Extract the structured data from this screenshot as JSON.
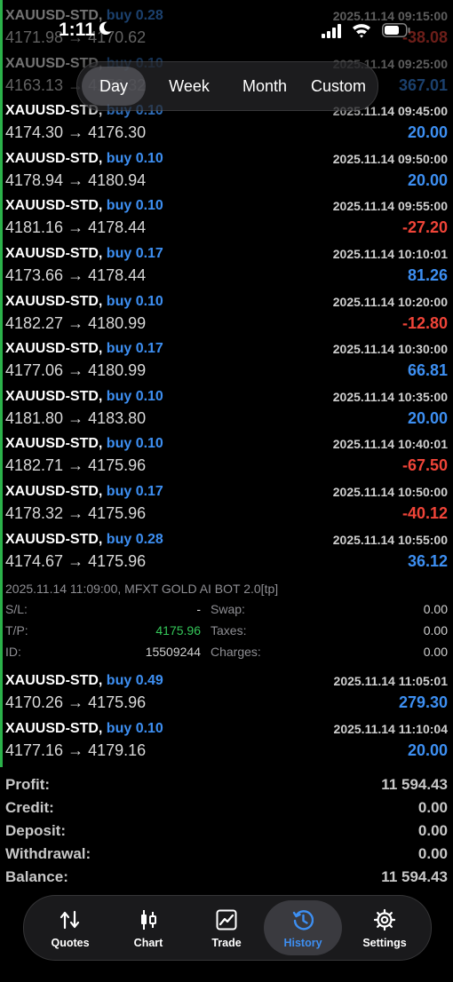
{
  "status_bar": {
    "time": "1:11"
  },
  "period_tabs": [
    "Day",
    "Week",
    "Month",
    "Custom"
  ],
  "deals": [
    {
      "symbol": "XAUUSD-STD,",
      "side": "buy 0.28",
      "datetime": "2025.11.14 09:15:00",
      "prices": "4171.98 → 4170.62",
      "profit": "-38.08",
      "dim": true
    },
    {
      "symbol": "XAUUSD-STD,",
      "side": "buy 0.10",
      "datetime": "2025.11.14 09:25:00",
      "prices": "4163.13 → 4176.32",
      "profit": "367.01",
      "dim": true
    },
    {
      "symbol": "XAUUSD-STD,",
      "side": "buy 0.10",
      "datetime": "2025.11.14 09:45:00",
      "prices": "4174.30 → 4176.30",
      "profit": "20.00"
    },
    {
      "symbol": "XAUUSD-STD,",
      "side": "buy 0.10",
      "datetime": "2025.11.14 09:50:00",
      "prices": "4178.94 → 4180.94",
      "profit": "20.00"
    },
    {
      "symbol": "XAUUSD-STD,",
      "side": "buy 0.10",
      "datetime": "2025.11.14 09:55:00",
      "prices": "4181.16 → 4178.44",
      "profit": "-27.20"
    },
    {
      "symbol": "XAUUSD-STD,",
      "side": "buy 0.17",
      "datetime": "2025.11.14 10:10:01",
      "prices": "4173.66 → 4178.44",
      "profit": "81.26"
    },
    {
      "symbol": "XAUUSD-STD,",
      "side": "buy 0.10",
      "datetime": "2025.11.14 10:20:00",
      "prices": "4182.27 → 4180.99",
      "profit": "-12.80"
    },
    {
      "symbol": "XAUUSD-STD,",
      "side": "buy 0.17",
      "datetime": "2025.11.14 10:30:00",
      "prices": "4177.06 → 4180.99",
      "profit": "66.81"
    },
    {
      "symbol": "XAUUSD-STD,",
      "side": "buy 0.10",
      "datetime": "2025.11.14 10:35:00",
      "prices": "4181.80 → 4183.80",
      "profit": "20.00"
    },
    {
      "symbol": "XAUUSD-STD,",
      "side": "buy 0.10",
      "datetime": "2025.11.14 10:40:01",
      "prices": "4182.71 → 4175.96",
      "profit": "-67.50"
    },
    {
      "symbol": "XAUUSD-STD,",
      "side": "buy 0.17",
      "datetime": "2025.11.14 10:50:00",
      "prices": "4178.32 → 4175.96",
      "profit": "-40.12"
    },
    {
      "symbol": "XAUUSD-STD,",
      "side": "buy 0.28",
      "datetime": "2025.11.14 10:55:00",
      "prices": "4174.67 → 4175.96",
      "profit": "36.12"
    }
  ],
  "details": {
    "header": "2025.11.14 11:09:00, MFXT GOLD AI BOT 2.0[tp]",
    "sl_label": "S/L:",
    "sl_value": "-",
    "tp_label": "T/P:",
    "tp_value": "4175.96",
    "id_label": "ID:",
    "id_value": "15509244",
    "swap_label": "Swap:",
    "swap_value": "0.00",
    "taxes_label": "Taxes:",
    "taxes_value": "0.00",
    "charges_label": "Charges:",
    "charges_value": "0.00"
  },
  "deals_after": [
    {
      "symbol": "XAUUSD-STD,",
      "side": "buy 0.49",
      "datetime": "2025.11.14 11:05:01",
      "prices": "4170.26 → 4175.96",
      "profit": "279.30"
    },
    {
      "symbol": "XAUUSD-STD,",
      "side": "buy 0.10",
      "datetime": "2025.11.14 11:10:04",
      "prices": "4177.16 → 4179.16",
      "profit": "20.00"
    }
  ],
  "summary": [
    {
      "label": "Profit:",
      "value": "11 594.43"
    },
    {
      "label": "Credit:",
      "value": "0.00"
    },
    {
      "label": "Deposit:",
      "value": "0.00"
    },
    {
      "label": "Withdrawal:",
      "value": "0.00"
    },
    {
      "label": "Balance:",
      "value": "11 594.43"
    }
  ],
  "tabbar": [
    {
      "label": "Quotes",
      "icon": "quotes-arrows-icon"
    },
    {
      "label": "Chart",
      "icon": "candlestick-icon"
    },
    {
      "label": "Trade",
      "icon": "trade-chart-icon"
    },
    {
      "label": "History",
      "icon": "history-clock-icon",
      "active": true
    },
    {
      "label": "Settings",
      "icon": "gear-icon"
    }
  ],
  "colors": {
    "positive": "#3d8ff2",
    "negative": "#f04438",
    "accent_bar": "#2bb24a",
    "tp_green": "#34c759"
  }
}
